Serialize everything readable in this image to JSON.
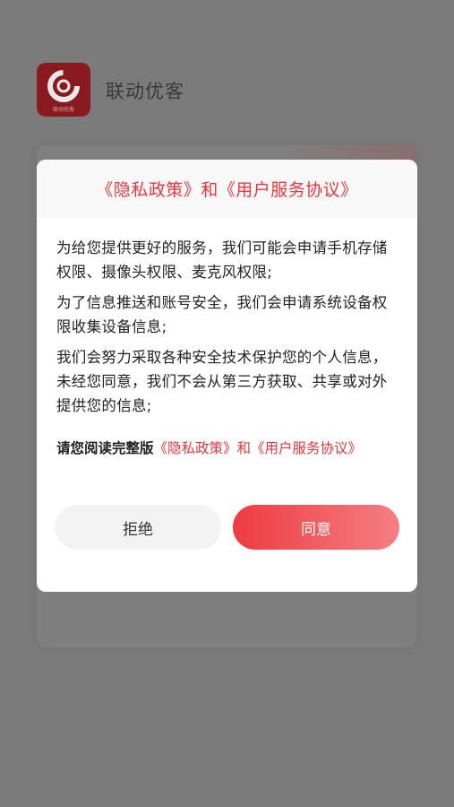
{
  "app": {
    "name": "联动优客",
    "logo_caption": "联动优客"
  },
  "dialog": {
    "title": "《隐私政策》和《用户服务协议》",
    "paragraphs": [
      "为给您提供更好的服务，我们可能会申请手机存储权限、摄像头权限、麦克风权限;",
      "为了信息推送和账号安全，我们会申请系统设备权限收集设备信息;",
      "我们会努力采取各种安全技术保护您的个人信息，未经您同意，我们不会从第三方获取、共享或对外提供您的信息;"
    ],
    "read_prefix": "请您阅读完整版",
    "privacy_link": "《隐私政策》",
    "and_text": "和",
    "agreement_link": "《用户服务协议》",
    "reject_label": "拒绝",
    "agree_label": "同意"
  },
  "colors": {
    "accent": "#e8383d",
    "logo_bg": "#8a1a1f"
  }
}
